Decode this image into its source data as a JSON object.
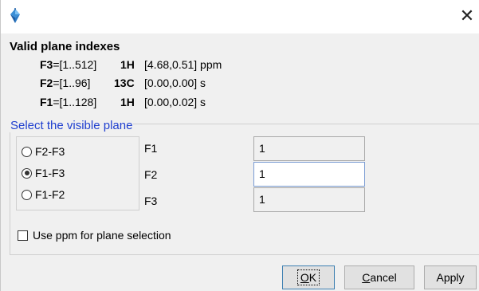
{
  "window": {
    "icon": "app-icon",
    "close_icon": "close-icon",
    "close_glyph": "✕"
  },
  "planes": {
    "title": "Valid plane indexes",
    "rows": [
      {
        "dim": "F3",
        "range": "=[1..512]",
        "nucleus": "1H",
        "limits": "[4.68,0.51] ppm"
      },
      {
        "dim": "F2",
        "range": "=[1..96]",
        "nucleus": "13C",
        "limits": "[0.00,0.00] s"
      },
      {
        "dim": "F1",
        "range": "=[1..128]",
        "nucleus": "1H",
        "limits": "[0.00,0.02] s"
      }
    ]
  },
  "select": {
    "legend": "Select the visible plane",
    "options": [
      {
        "label": "F2-F3",
        "checked": false
      },
      {
        "label": "F1-F3",
        "checked": true
      },
      {
        "label": "F1-F2",
        "checked": false
      }
    ],
    "fields": [
      {
        "label": "F1",
        "value": "1",
        "active": false
      },
      {
        "label": "F2",
        "value": "1",
        "active": true
      },
      {
        "label": "F3",
        "value": "1",
        "active": false
      }
    ],
    "use_ppm_label": "Use ppm for plane selection",
    "use_ppm_checked": false
  },
  "buttons": {
    "ok_mnemonic": "O",
    "ok_rest": "K",
    "cancel_mnemonic": "C",
    "cancel_rest": "ancel",
    "apply": "Apply"
  },
  "colors": {
    "legend": "#1f3fcf",
    "dialog_bg": "#f0f0f0",
    "default_button_border": "#3c7fb1"
  }
}
